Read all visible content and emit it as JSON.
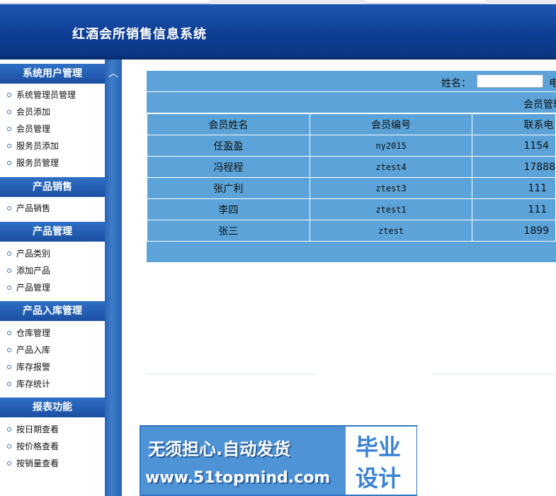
{
  "app": {
    "title": "红酒会所销售信息系统"
  },
  "sidebar": {
    "collapse_glyph": "︿",
    "groups": [
      {
        "title": "系统用户管理",
        "items": [
          "系统管理员管理",
          "会员添加",
          "会员管理",
          "服务员添加",
          "服务员管理"
        ]
      },
      {
        "title": "产品销售",
        "items": [
          "产品销售"
        ]
      },
      {
        "title": "产品管理",
        "items": [
          "产品类别",
          "添加产品",
          "产品管理"
        ]
      },
      {
        "title": "产品入库管理",
        "items": [
          "仓库管理",
          "产品入库",
          "库存报警",
          "库存统计"
        ]
      },
      {
        "title": "报表功能",
        "items": [
          "按日期查看",
          "按价格查看",
          "按销量查看"
        ]
      }
    ]
  },
  "main": {
    "search": {
      "name_label": "姓名：",
      "name_value": "",
      "trailing_label": "电"
    },
    "caption": "会员管理",
    "columns": [
      "会员姓名",
      "会员编号",
      "联系电"
    ],
    "rows": [
      [
        "任盈盈",
        "ny2015",
        "1154"
      ],
      [
        "冯程程",
        "ztest4",
        "17888"
      ],
      [
        "张广利",
        "ztest3",
        "111"
      ],
      [
        "李四",
        "ztest1",
        "111"
      ],
      [
        "张三",
        "ztest",
        "1899"
      ]
    ]
  },
  "banner": {
    "line1": "无须担心.自动发货",
    "line2": "www.51topmind.com",
    "box_line1": "毕业",
    "box_line2": "设计"
  },
  "colors": {
    "header": "#1d56b0",
    "sidebar_header": "#2e6fc4",
    "table_bg": "#5ba3d8",
    "banner_bg": "#4d93d6"
  }
}
